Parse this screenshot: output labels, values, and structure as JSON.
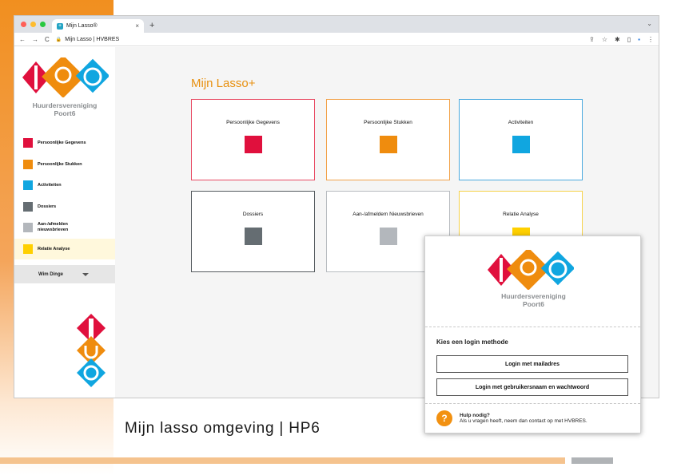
{
  "browser": {
    "tab_title": "Mijn Lasso®",
    "tab_close": "×",
    "new_tab": "+",
    "url": "Mijn Lasso | HVBRES",
    "nav_back": "←",
    "nav_forward": "→",
    "nav_reload": "C",
    "tool_icons": [
      "share-icon",
      "star-icon",
      "puzzle-icon",
      "sidebar-icon",
      "extension-icon",
      "more-icon"
    ],
    "tab_chevron": "⌄"
  },
  "sidebar": {
    "org_line1": "Huurdersvereniging",
    "org_line2": "Poort6",
    "items": [
      {
        "label": "Persoonlijke Gegevens",
        "color": "#e0103d"
      },
      {
        "label": "Persoonlijke Stukken",
        "color": "#ef8c0e"
      },
      {
        "label": "Activiteiten",
        "color": "#10a6e0"
      },
      {
        "label": "Dossiers",
        "color": "#656d72"
      },
      {
        "label": "Aan-/afmelden nieuwsbrieven",
        "color": "#b3b7bc"
      },
      {
        "label": "Relatie Analyse",
        "color": "#ffd000"
      }
    ],
    "user_name": "Wim Dinge"
  },
  "main": {
    "title": "Mijn Lasso+",
    "cards": [
      {
        "label": "Persoonlijke Gegevens",
        "color": "#e0103d",
        "border": "#e84a63"
      },
      {
        "label": "Persoonlijke Stukken",
        "color": "#ef8c0e",
        "border": "#f2a24a"
      },
      {
        "label": "Activiteiten",
        "color": "#10a6e0",
        "border": "#4aa9df"
      },
      {
        "label": "Dossiers",
        "color": "#656d72",
        "border": "#555b5f"
      },
      {
        "label": "Aan-/afmeldem Nieuwsbrieven",
        "color": "#b3b7bc",
        "border": "#b8bcc0"
      },
      {
        "label": "Relatie Analyse",
        "color": "#ffd000",
        "border": "#f6d24a"
      }
    ]
  },
  "login": {
    "org_line1": "Huurdersvereniging",
    "org_line2": "Poort6",
    "heading": "Kies een login methode",
    "btn_email": "Login met mailadres",
    "btn_user": "Login met gebruikersnaam en wachtwoord",
    "help_icon": "?",
    "help_title": "Hulp nodig?",
    "help_text": "Als u vragen heeft, neem dan contact op met HVBRES."
  },
  "caption": "Mijn lasso omgeving | HP6",
  "colors": {
    "accent": "#e8900f",
    "red": "#e0103d",
    "orange": "#ef8c0e",
    "blue": "#10a6e0"
  }
}
